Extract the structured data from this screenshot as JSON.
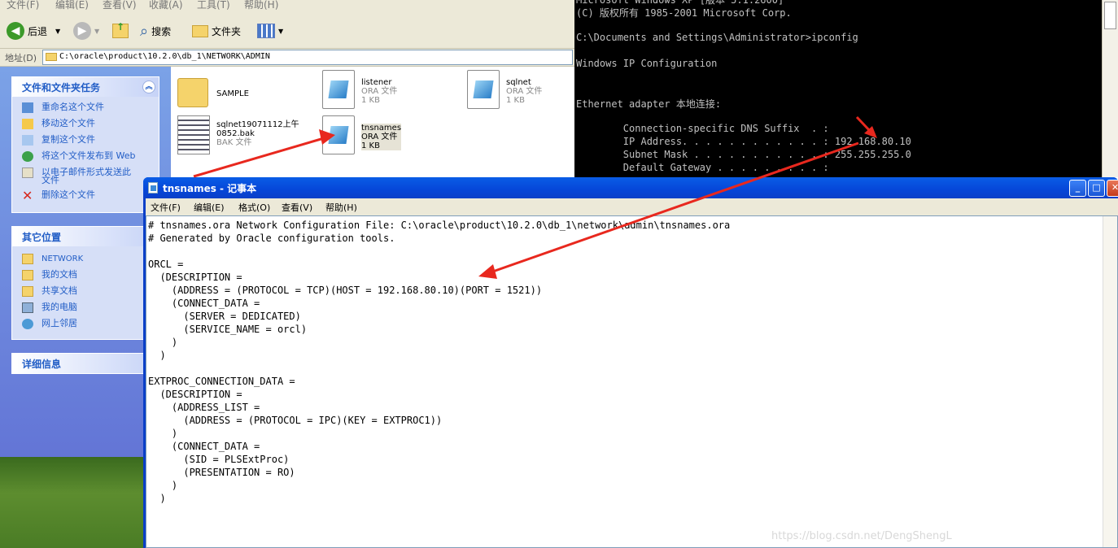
{
  "explorer": {
    "menu": [
      "文件(F)",
      "编辑(E)",
      "查看(V)",
      "收藏(A)",
      "工具(T)",
      "帮助(H)"
    ],
    "toolbar": {
      "back": "后退",
      "search": "搜索",
      "folders": "文件夹"
    },
    "address_label": "地址(D)",
    "address_value": "C:\\oracle\\product\\10.2.0\\db_1\\NETWORK\\ADMIN",
    "file_tasks": {
      "title": "文件和文件夹任务",
      "items": [
        "重命名这个文件",
        "移动这个文件",
        "复制这个文件",
        "将这个文件发布到 Web",
        "以电子邮件形式发送此",
        "文件",
        "删除这个文件"
      ]
    },
    "other_places": {
      "title": "其它位置",
      "items": [
        "NETWORK",
        "我的文档",
        "共享文档",
        "我的电脑",
        "网上邻居"
      ]
    },
    "details": {
      "title": "详细信息"
    },
    "files": [
      {
        "name": "SAMPLE"
      },
      {
        "name": "listener",
        "type": "ORA 文件",
        "size": "1 KB"
      },
      {
        "name": "sqlnet",
        "type": "ORA 文件",
        "size": "1 KB"
      },
      {
        "name": "sqlnet19071112上午",
        "name2": "0852.bak",
        "type": "BAK 文件"
      },
      {
        "name": "tnsnames",
        "type": "ORA 文件",
        "size": "1 KB"
      }
    ]
  },
  "cmd": {
    "lines": [
      "Microsoft Windows XP [版本 5.1.2600]",
      "(C) 版权所有 1985-2001 Microsoft Corp.",
      "",
      "C:\\Documents and Settings\\Administrator>ipconfig",
      "",
      "Windows IP Configuration",
      "",
      "",
      "Ethernet adapter 本地连接:",
      "",
      "        Connection-specific DNS Suffix  . :",
      "        IP Address. . . . . . . . . . . . : 192.168.80.10",
      "        Subnet Mask . . . . . . . . . . . : 255.255.255.0",
      "        Default Gateway . . . . . . . . . :"
    ]
  },
  "notepad": {
    "title": "tnsnames - 记事本",
    "menu": [
      "文件(F)",
      "编辑(E)",
      "格式(O)",
      "查看(V)",
      "帮助(H)"
    ],
    "content": "# tnsnames.ora Network Configuration File: C:\\oracle\\product\\10.2.0\\db_1\\network\\admin\\tnsnames.ora\n# Generated by Oracle configuration tools.\n\nORCL =\n  (DESCRIPTION =\n    (ADDRESS = (PROTOCOL = TCP)(HOST = 192.168.80.10)(PORT = 1521))\n    (CONNECT_DATA =\n      (SERVER = DEDICATED)\n      (SERVICE_NAME = orcl)\n    )\n  )\n\nEXTPROC_CONNECTION_DATA =\n  (DESCRIPTION =\n    (ADDRESS_LIST =\n      (ADDRESS = (PROTOCOL = IPC)(KEY = EXTPROC1))\n    )\n    (CONNECT_DATA =\n      (SID = PLSExtProc)\n      (PRESENTATION = RO)\n    )\n  )"
  },
  "watermark": "https://blog.csdn.net/DengShengL",
  "colors": {
    "annotation_arrow": "#e8281e",
    "task_link": "#215dc6",
    "titlebar": "#0a5de6"
  }
}
